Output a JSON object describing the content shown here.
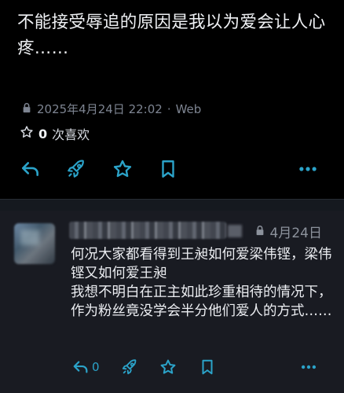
{
  "post": {
    "text": "不能接受辱追的原因是我以为爱会让人心疼……",
    "timestamp": "2025年4月24日 22:02",
    "separator": "·",
    "client": "Web",
    "favorites_count": "0",
    "favorites_label": "次喜欢",
    "actions": [
      "reply-icon",
      "boost-icon",
      "favorite-icon",
      "bookmark-icon",
      "more-icon"
    ]
  },
  "reply": {
    "time": "4月24日",
    "text_lines": [
      "何况大家都看得到王昶如何爱梁伟铿，梁伟铿又如何爱王昶",
      "我想不明白在正主如此珍重相待的情况下，作为粉丝竟没学会半分他们爱人的方式……"
    ],
    "reply_count": "0"
  },
  "colors": {
    "accent": "#2ba3c9",
    "muted": "#7d8491",
    "background": "#000000",
    "reply_background": "#191b22"
  }
}
